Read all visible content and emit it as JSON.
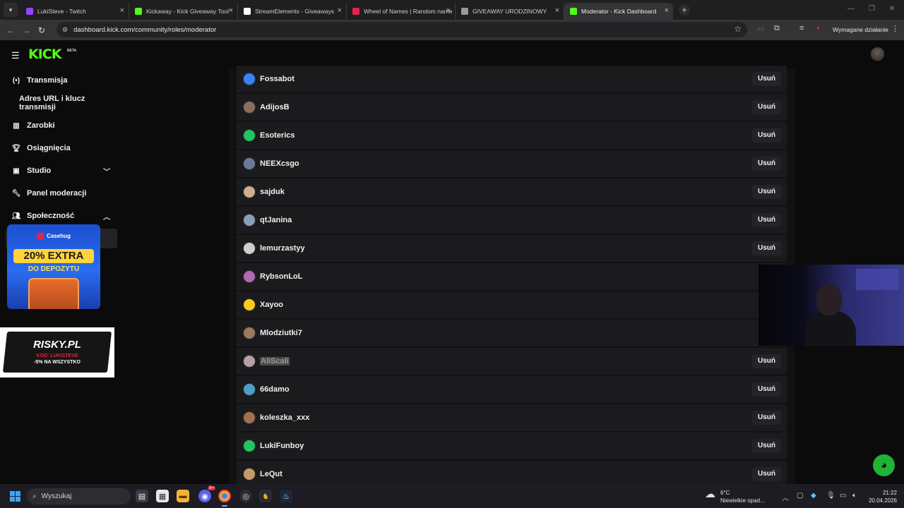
{
  "browser": {
    "tabs": [
      {
        "title": "LukiSteve - Twitch",
        "favicon_color": "#9146ff"
      },
      {
        "title": "Kickaway - Kick Giveaway Tool",
        "favicon_color": "#53fc18"
      },
      {
        "title": "StreamElements - Giveaways",
        "favicon_color": "#ffffff"
      },
      {
        "title": "Wheel of Names | Random name",
        "favicon_color": "#e5234b"
      },
      {
        "title": "GIVEAWAY URODZINOWY",
        "favicon_color": "#9a9a9a"
      },
      {
        "title": "Moderator - Kick Dashboard",
        "favicon_color": "#53fc18"
      }
    ],
    "active_tab": 5,
    "url": "dashboard.kick.com/community/roles/moderator",
    "action_required": "Wymagane działanie"
  },
  "header": {
    "logo": "KICK",
    "logo_badge": "BETA"
  },
  "sidebar": {
    "items": [
      {
        "label": "Transmisja",
        "icon": "broadcast-icon"
      },
      {
        "label": "Adres URL i klucz transmisji",
        "icon": ""
      },
      {
        "label": "Zarobki",
        "icon": "earnings-icon"
      },
      {
        "label": "Osiągnięcia",
        "icon": "trophy-icon"
      },
      {
        "label": "Studio",
        "icon": "studio-icon"
      },
      {
        "label": "Panel moderacji",
        "icon": "wrench-icon"
      },
      {
        "label": "Społeczność",
        "icon": "community-icon"
      }
    ]
  },
  "overlays": {
    "ad_casehug": {
      "brand": "Casehug",
      "headline": "20% EXTRA",
      "subline": "DO DEPOZYTU"
    },
    "ad_risky": {
      "brand": "RISKY.PL",
      "code": "KOD: LUKISTEVE",
      "offer": "-5% NA WSZYSTKO"
    }
  },
  "moderators": {
    "remove_label": "Usuń",
    "rows": [
      {
        "name": "Fossabot",
        "avatar_color": "#3b82f6",
        "removable": true
      },
      {
        "name": "AdijosB",
        "avatar_color": "#8a6f5a",
        "removable": true
      },
      {
        "name": "Esoterics",
        "avatar_color": "#22c55e",
        "removable": true
      },
      {
        "name": "NEEXcsgo",
        "avatar_color": "#6a7a9a",
        "removable": true
      },
      {
        "name": "sajduk",
        "avatar_color": "#c9b08f",
        "removable": true
      },
      {
        "name": "qtJanina",
        "avatar_color": "#8aa0b8",
        "removable": true
      },
      {
        "name": "lemurzastyy",
        "avatar_color": "#cfcfcf",
        "removable": true
      },
      {
        "name": "RybsonLoL",
        "avatar_color": "#b06ab0",
        "removable": false
      },
      {
        "name": "Xayoo",
        "avatar_color": "#facc15",
        "removable": false
      },
      {
        "name": "Mlodziutki7",
        "avatar_color": "#9a7a5a",
        "removable": false
      },
      {
        "name": "AliScali",
        "avatar_color": "#b8a0a0",
        "removable": true,
        "dimmed": true
      },
      {
        "name": "66damo",
        "avatar_color": "#4aa0c8",
        "removable": true
      },
      {
        "name": "koleszka_xxx",
        "avatar_color": "#a07050",
        "removable": true
      },
      {
        "name": "LukiFunboy",
        "avatar_color": "#22c55e",
        "removable": true
      },
      {
        "name": "LeQut",
        "avatar_color": "#c89a6a",
        "removable": true
      }
    ]
  },
  "taskbar": {
    "search_placeholder": "Wyszukaj",
    "weather_temp": "6°C",
    "weather_desc": "Niewielkie opad...",
    "time": "21:22",
    "date": "20.04.2026",
    "discord_badge": "9+"
  },
  "colors": {
    "kick_green": "#53fc18",
    "row_bg": "#1b1b1e",
    "panel_bg": "#111113"
  }
}
